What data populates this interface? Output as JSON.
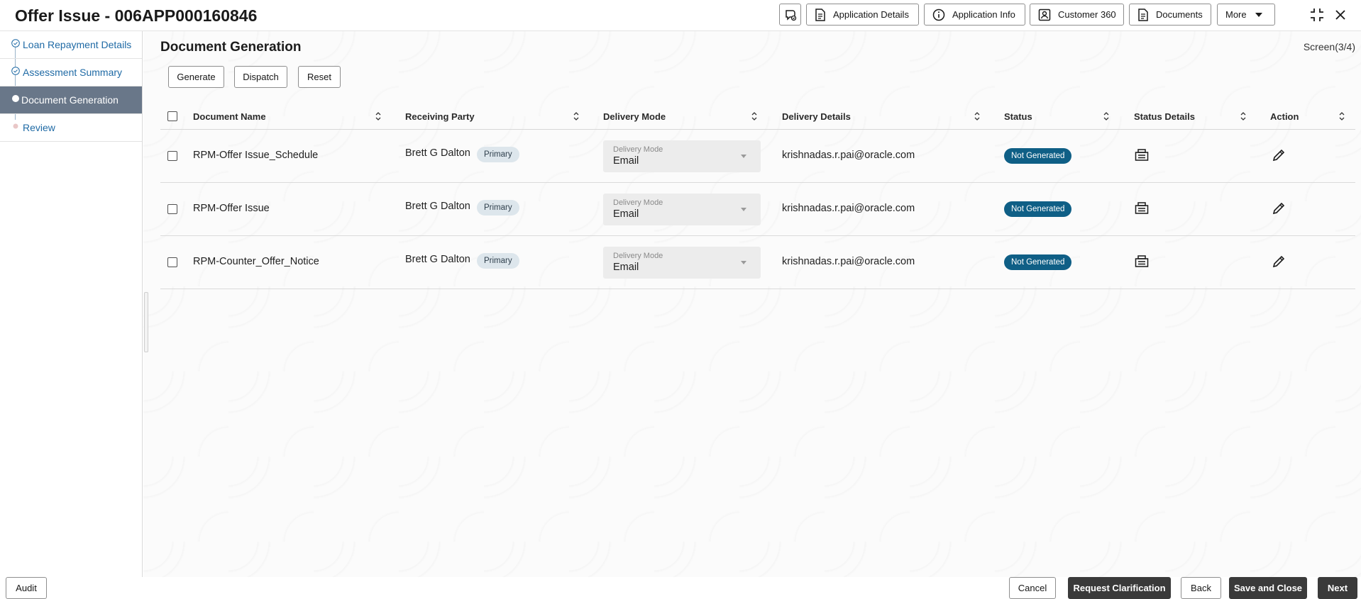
{
  "header": {
    "title": "Offer Issue - 006APP000160846",
    "buttons": {
      "application_details": "Application Details",
      "application_info": "Application Info",
      "customer_360": "Customer 360",
      "documents": "Documents",
      "more": "More"
    },
    "icons": [
      "chat-icon",
      "document-icon",
      "info-icon",
      "contact-card-icon",
      "documents-icon",
      "collapse-icon",
      "close-icon"
    ]
  },
  "sidebar": {
    "steps": [
      {
        "label": "Loan Repayment Details",
        "state": "completed"
      },
      {
        "label": "Assessment Summary",
        "state": "completed"
      },
      {
        "label": "Document Generation",
        "state": "active"
      },
      {
        "label": "Review",
        "state": "pending"
      }
    ]
  },
  "main": {
    "section_title": "Document Generation",
    "screen_indicator": "Screen(3/4)",
    "actions": {
      "generate": "Generate",
      "dispatch": "Dispatch",
      "reset": "Reset"
    },
    "table": {
      "columns": [
        "Document Name",
        "Receiving Party",
        "Delivery Mode",
        "Delivery Details",
        "Status",
        "Status Details",
        "Action"
      ],
      "rows": [
        {
          "document_name": "RPM-Offer Issue_Schedule",
          "receiving_party": "Brett G Dalton",
          "party_badge": "Primary",
          "delivery_mode_label": "Delivery Mode",
          "delivery_mode": "Email",
          "delivery_details": "krishnadas.r.pai@oracle.com",
          "status": "Not Generated"
        },
        {
          "document_name": "RPM-Offer Issue",
          "receiving_party": "Brett G Dalton",
          "party_badge": "Primary",
          "delivery_mode_label": "Delivery Mode",
          "delivery_mode": "Email",
          "delivery_details": "krishnadas.r.pai@oracle.com",
          "status": "Not Generated"
        },
        {
          "document_name": "RPM-Counter_Offer_Notice",
          "receiving_party": "Brett G Dalton",
          "party_badge": "Primary",
          "delivery_mode_label": "Delivery Mode",
          "delivery_mode": "Email",
          "delivery_details": "krishnadas.r.pai@oracle.com",
          "status": "Not Generated"
        }
      ]
    }
  },
  "footer": {
    "audit": "Audit",
    "cancel": "Cancel",
    "request_clarification": "Request Clarification",
    "back": "Back",
    "save_and_close": "Save and Close",
    "next": "Next"
  },
  "colors": {
    "active_step_bg": "#697789",
    "status_badge_bg": "#0f5f86",
    "link_blue": "#1f6aa5",
    "primary_button_bg": "#3a3a3a"
  }
}
